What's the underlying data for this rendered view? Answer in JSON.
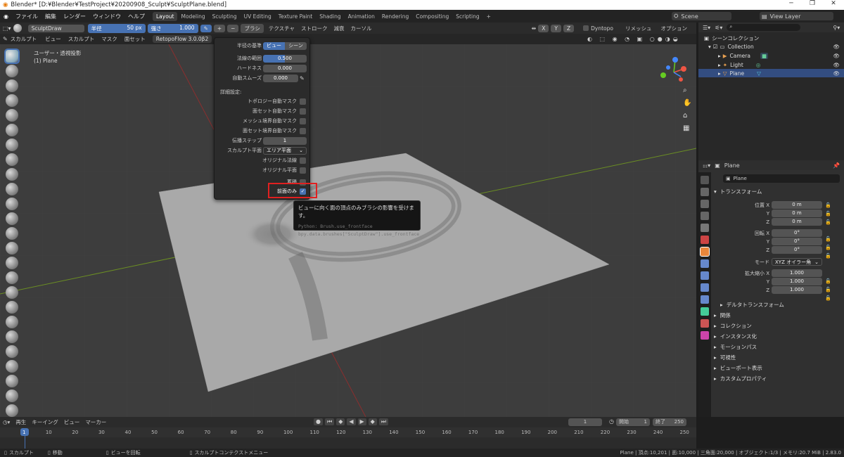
{
  "window_title": "Blender* [D:¥Blender¥TestProject¥20200908_Sculpt¥SculptPlane.blend]",
  "menu": [
    "ファイル",
    "編集",
    "レンダー",
    "ウィンドウ",
    "ヘルプ"
  ],
  "workspaces": [
    "Layout",
    "Modeling",
    "Sculpting",
    "UV Editing",
    "Texture Paint",
    "Shading",
    "Animation",
    "Rendering",
    "Compositing",
    "Scripting"
  ],
  "active_workspace": "Layout",
  "scene": "Scene",
  "view_layer": "View Layer",
  "tool_header": {
    "brush_name": "SculptDraw",
    "radius_label": "半径",
    "radius_value": "50 px",
    "strength_label": "強さ",
    "strength_value": "1.000",
    "minus": "−",
    "brush_menu": "ブラシ",
    "texture_menu": "テクスチャ",
    "stroke_menu": "ストローク",
    "falloff_menu": "減衰",
    "cursor_menu": "カーソル",
    "axes": [
      "X",
      "Y",
      "Z"
    ],
    "dyntopo": "Dyntopo",
    "remesh": "リメッシュ",
    "options": "オプション"
  },
  "sub_header": {
    "mode": "スカルプト",
    "items": [
      "ビュー",
      "スカルプト",
      "マスク",
      "面セット"
    ],
    "addon": "RetopoFlow 3.0.0β2"
  },
  "viewport": {
    "view_name": "ユーザー・透視投影",
    "object_label": "(1) Plane"
  },
  "popup": {
    "radius_base_label": "半径の基準",
    "radius_base_options": [
      "ビュー",
      "シーン"
    ],
    "normal_radius_label": "法線の範囲",
    "normal_radius_value": "0.500",
    "hardness_label": "ハードネス",
    "hardness_value": "0.000",
    "auto_smooth_label": "自動スムーズ",
    "auto_smooth_value": "0.000",
    "advanced_label": "詳細設定:",
    "checks": [
      "トポロジー自動マスク",
      "面セット自動マスク",
      "メッシュ境界自動マスク",
      "面セット境界自動マスク"
    ],
    "propagation_label": "伝播ステップ",
    "propagation_value": "1",
    "sculpt_plane_label": "スカルプト平面",
    "sculpt_plane_value": "エリア平面",
    "original_normal": "オリジナル法線",
    "original_plane": "オリジナル平面",
    "accumulate": "蓄積",
    "front_faces_only": "前面のみ",
    "check_mark": "✓"
  },
  "tooltip": {
    "text": "ビューに向く面の頂点のみブラシの影響を受けます。",
    "python1": "Python: Brush.use_frontface",
    "python2": "bpy.data.brushes[\"SculptDraw\"].use_frontface"
  },
  "outliner": {
    "scene_collection": "シーンコレクション",
    "items": [
      "Collection",
      "Camera",
      "Light",
      "Plane"
    ]
  },
  "properties": {
    "object_name": "Plane",
    "data_name": "Plane",
    "transform_header": "トランスフォーム",
    "location_label": "位置 X",
    "rotation_label": "回転 X",
    "scale_label": "拡大縮小 X",
    "y_label": "Y",
    "z_label": "Z",
    "loc_values": [
      "0 m",
      "0 m",
      "0 m"
    ],
    "rot_values": [
      "0°",
      "0°",
      "0°"
    ],
    "scale_values": [
      "1.000",
      "1.000",
      "1.000"
    ],
    "mode_label": "モード",
    "mode_value": "XYZ オイラー角",
    "delta_header": "デルタトランスフォーム",
    "panels": [
      "関係",
      "コレクション",
      "インスタンス化",
      "モーションパス",
      "可視性",
      "ビューポート表示",
      "カスタムプロパティ"
    ]
  },
  "timeline": {
    "menus": [
      "再生",
      "キーイング",
      "ビュー",
      "マーカー"
    ],
    "current_frame": "1",
    "start_label": "開始",
    "start_value": "1",
    "end_label": "終了",
    "end_value": "250",
    "frames": [
      "1",
      "10",
      "20",
      "30",
      "40",
      "50",
      "60",
      "70",
      "80",
      "90",
      "100",
      "110",
      "120",
      "130",
      "140",
      "150",
      "160",
      "170",
      "180",
      "190",
      "200",
      "210",
      "220",
      "230",
      "240",
      "250"
    ]
  },
  "status": {
    "left1": "スカルプト",
    "left2": "移動",
    "left3": "ビューを回転",
    "left4": "スカルプトコンテクストメニュー",
    "right": "Plane | 頂点:10,201 | 面:10,000 | 三角面:20,000 | オブジェクト:1/3 | メモリ:20.7 MiB | 2.83.0"
  },
  "colors": {
    "accent": "#4772b3",
    "highlight_box": "#e02020"
  }
}
